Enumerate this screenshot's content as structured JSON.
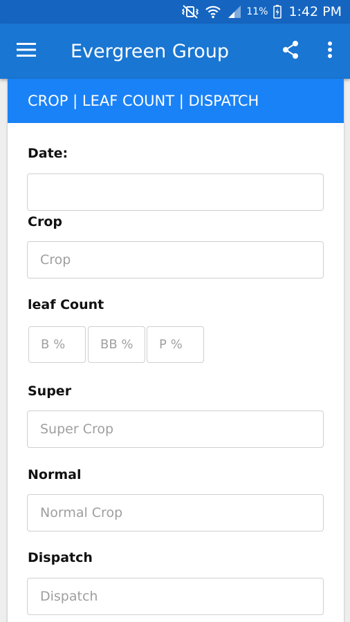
{
  "status_bar": {
    "icons": [
      "mute-vibrate-icon",
      "wifi-icon",
      "signal-icon",
      "battery-charging-icon"
    ],
    "battery_percent": "11%",
    "time": "1:42 PM"
  },
  "app_bar": {
    "title": "Evergreen Group",
    "icons": [
      "menu-icon",
      "share-icon",
      "more-vert-icon"
    ]
  },
  "card": {
    "header": "CROP | LEAF COUNT | DISPATCH"
  },
  "form": {
    "date_label": "Date:",
    "date_value": "",
    "crop_label": "Crop",
    "crop_placeholder": "Crop",
    "leaf_count_label": "leaf Count",
    "b_placeholder": "B %",
    "bb_placeholder": "BB %",
    "p_placeholder": "P %",
    "super_label": "Super",
    "super_placeholder": "Super Crop",
    "normal_label": "Normal",
    "normal_placeholder": "Normal Crop",
    "dispatch_label": "Dispatch",
    "dispatch_placeholder": "Dispatch"
  },
  "colors": {
    "status_bar": "#1565c0",
    "app_bar": "#1976d2",
    "card_header": "#1a82f7",
    "background": "#eeeeee"
  }
}
